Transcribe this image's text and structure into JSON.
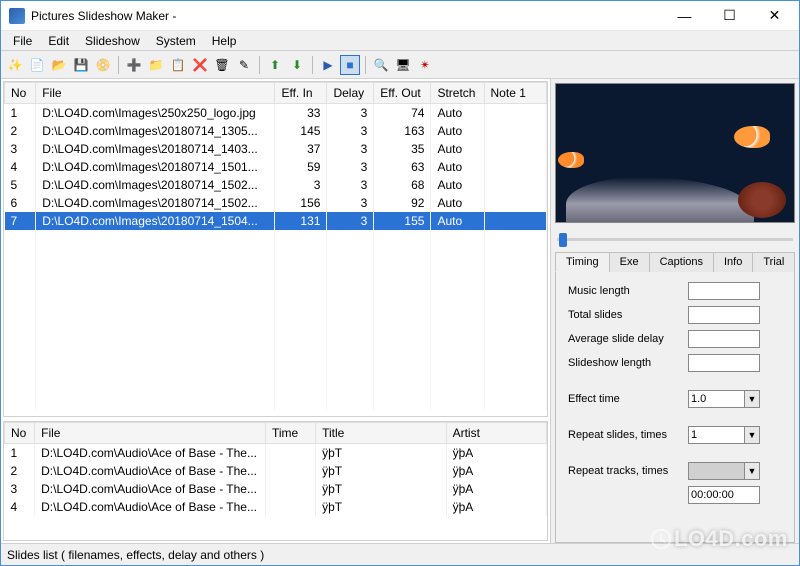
{
  "window": {
    "title": "Pictures Slideshow Maker -"
  },
  "menu": [
    "File",
    "Edit",
    "Slideshow",
    "System",
    "Help"
  ],
  "toolbar_icons": [
    "wizard-icon",
    "new-icon",
    "open-icon",
    "save-icon",
    "save-as-icon",
    "sep",
    "add-file-icon",
    "add-folder-icon",
    "batch-icon",
    "delete-icon",
    "clear-icon",
    "edit-icon",
    "sep",
    "move-up-icon",
    "move-down-icon",
    "sep",
    "play-icon",
    "stop-icon",
    "sep",
    "preview-icon",
    "fullscreen-icon",
    "settings-icon"
  ],
  "slides_columns": [
    "No",
    "File",
    "Eff. In",
    "Delay",
    "Eff. Out",
    "Stretch",
    "Note 1"
  ],
  "slides": [
    {
      "no": "1",
      "file": "D:\\LO4D.com\\Images\\250x250_logo.jpg",
      "eff_in": "33",
      "delay": "3",
      "eff_out": "74",
      "stretch": "Auto",
      "note": ""
    },
    {
      "no": "2",
      "file": "D:\\LO4D.com\\Images\\20180714_1305...",
      "eff_in": "145",
      "delay": "3",
      "eff_out": "163",
      "stretch": "Auto",
      "note": ""
    },
    {
      "no": "3",
      "file": "D:\\LO4D.com\\Images\\20180714_1403...",
      "eff_in": "37",
      "delay": "3",
      "eff_out": "35",
      "stretch": "Auto",
      "note": ""
    },
    {
      "no": "4",
      "file": "D:\\LO4D.com\\Images\\20180714_1501...",
      "eff_in": "59",
      "delay": "3",
      "eff_out": "63",
      "stretch": "Auto",
      "note": ""
    },
    {
      "no": "5",
      "file": "D:\\LO4D.com\\Images\\20180714_1502...",
      "eff_in": "3",
      "delay": "3",
      "eff_out": "68",
      "stretch": "Auto",
      "note": ""
    },
    {
      "no": "6",
      "file": "D:\\LO4D.com\\Images\\20180714_1502...",
      "eff_in": "156",
      "delay": "3",
      "eff_out": "92",
      "stretch": "Auto",
      "note": ""
    },
    {
      "no": "7",
      "file": "D:\\LO4D.com\\Images\\20180714_1504...",
      "eff_in": "131",
      "delay": "3",
      "eff_out": "155",
      "stretch": "Auto",
      "note": "",
      "selected": true
    }
  ],
  "audio_columns": [
    "No",
    "File",
    "Time",
    "Title",
    "Artist"
  ],
  "audio": [
    {
      "no": "1",
      "file": "D:\\LO4D.com\\Audio\\Ace of Base - The...",
      "time": "",
      "title": "ÿþT",
      "artist": "ÿþA"
    },
    {
      "no": "2",
      "file": "D:\\LO4D.com\\Audio\\Ace of Base - The...",
      "time": "",
      "title": "ÿþT",
      "artist": "ÿþA"
    },
    {
      "no": "3",
      "file": "D:\\LO4D.com\\Audio\\Ace of Base - The...",
      "time": "",
      "title": "ÿþT",
      "artist": "ÿþA"
    },
    {
      "no": "4",
      "file": "D:\\LO4D.com\\Audio\\Ace of Base - The...",
      "time": "",
      "title": "ÿþT",
      "artist": "ÿþA"
    }
  ],
  "tabs": [
    "Timing",
    "Exe",
    "Captions",
    "Info",
    "Trial"
  ],
  "active_tab": 0,
  "timing": {
    "music_length_label": "Music length",
    "music_length": "",
    "total_slides_label": "Total slides",
    "total_slides": "",
    "avg_delay_label": "Average slide delay",
    "avg_delay": "",
    "slideshow_length_label": "Slideshow length",
    "slideshow_length": "",
    "effect_time_label": "Effect time",
    "effect_time": "1.0",
    "repeat_slides_label": "Repeat slides, times",
    "repeat_slides": "1",
    "repeat_tracks_label": "Repeat tracks, times",
    "repeat_tracks": "",
    "time_readout": "00:00:00"
  },
  "statusbar": "Slides list ( filenames, effects, delay and others )",
  "watermark": "LO4D.com"
}
